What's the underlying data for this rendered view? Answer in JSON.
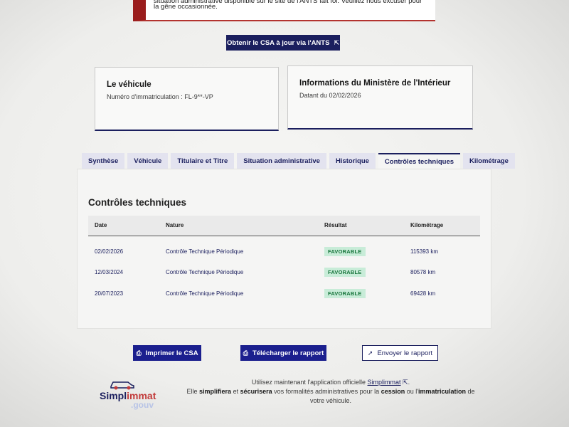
{
  "alert": {
    "line1": "situation administrative disponible sur le site de l'ANTS fait foi. Veuillez nous excuser pour",
    "line2": "la gêne occasionnée."
  },
  "csa_button": {
    "label": "Obtenir le CSA à jour via l'ANTS",
    "icon": "external-link-icon"
  },
  "vehicle_card": {
    "title": "Le véhicule",
    "text": "Numéro d'immatriculation : FL-9**-VP"
  },
  "ministry_card": {
    "title": "Informations du Ministère de l'Intérieur",
    "text": "Datant du 02/02/2026"
  },
  "tabs": [
    {
      "label": "Synthèse"
    },
    {
      "label": "Véhicule"
    },
    {
      "label": "Titulaire et Titre"
    },
    {
      "label": "Situation administrative"
    },
    {
      "label": "Historique"
    },
    {
      "label": "Contrôles techniques"
    },
    {
      "label": "Kilométrage"
    }
  ],
  "active_tab": "Contrôles techniques",
  "section": {
    "title": "Contrôles techniques",
    "columns": [
      "Date",
      "Nature",
      "Résultat",
      "Kilométrage"
    ],
    "rows": [
      {
        "date": "02/02/2026",
        "nature": "Contrôle Technique Périodique",
        "result": "FAVORABLE",
        "km": "115393 km"
      },
      {
        "date": "12/03/2024",
        "nature": "Contrôle Technique Périodique",
        "result": "FAVORABLE",
        "km": "80578 km"
      },
      {
        "date": "20/07/2023",
        "nature": "Contrôle Technique Périodique",
        "result": "FAVORABLE",
        "km": "69428 km"
      }
    ]
  },
  "actions": {
    "print": "Imprimer le CSA",
    "download": "Télécharger le rapport",
    "send": "Envoyer le rapport"
  },
  "footer": {
    "logo_name_a": "Simpl",
    "logo_name_b": "immat",
    "logo_suffix": ".gouv",
    "line1_before": "Utilisez maintenant l'application officielle ",
    "link": "Simplimmat",
    "line1_after": ".",
    "line2_a": "Elle ",
    "line2_b": "simplifiera",
    "line2_c": " et ",
    "line2_d": "sécurisera",
    "line2_e": " vos formalités administratives pour la ",
    "line2_f": "cession",
    "line2_g": " ou l'",
    "line2_h": "immatriculation",
    "line2_i": " de",
    "line3": "votre véhicule."
  },
  "colors": {
    "primary": "#1b1f5e",
    "alert_red": "#9a1d1d",
    "success_bg": "#c8ecd8",
    "success_text": "#18753c"
  }
}
